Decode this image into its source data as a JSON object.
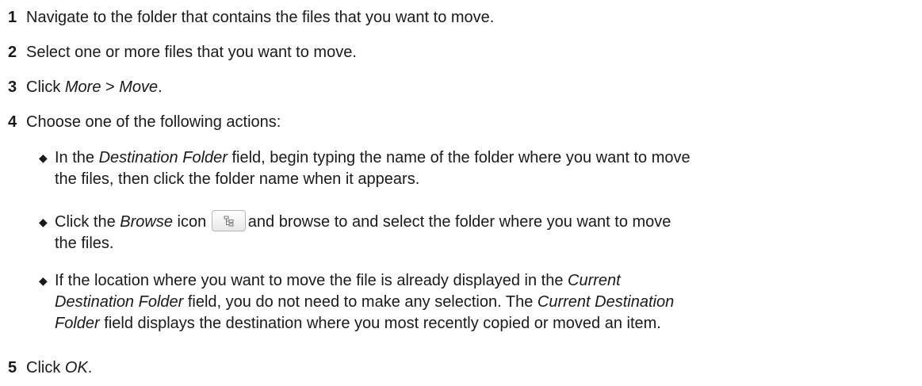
{
  "steps": [
    {
      "num": "1",
      "text": "Navigate to the folder that contains the files that you want to move."
    },
    {
      "num": "2",
      "text": "Select one or more files that you want to move."
    },
    {
      "num": "3",
      "prefix": "Click ",
      "em1": "More",
      "mid": " > ",
      "em2": "Move",
      "suffix": "."
    },
    {
      "num": "4",
      "text": "Choose one of the following actions:"
    },
    {
      "num": "5",
      "prefix": "Click ",
      "em": "OK",
      "suffix": "."
    }
  ],
  "bullets": [
    {
      "line1_pre": "In the ",
      "line1_em": "Destination Folder",
      "line1_post": " field, begin typing the name of the folder where you want to move",
      "line2": "the files, then click the folder name when it appears."
    },
    {
      "line1_pre": "Click the ",
      "line1_em": "Browse",
      "line1_mid": " icon",
      "line1_post": "and browse to and select the folder where you want to move",
      "line2": "the files."
    },
    {
      "line1_pre": "If the location where you want to move the file is already displayed in the ",
      "line1_em": "Current",
      "line2_em": "Destination Folder",
      "line2_mid": " field, you do not need to make any selection. The ",
      "line2_em2": "Current Destination",
      "line3_em": "Folder",
      "line3_post": " field displays the destination where you most recently copied or moved an item."
    }
  ],
  "icons": {
    "browse": "folder-tree-icon"
  }
}
